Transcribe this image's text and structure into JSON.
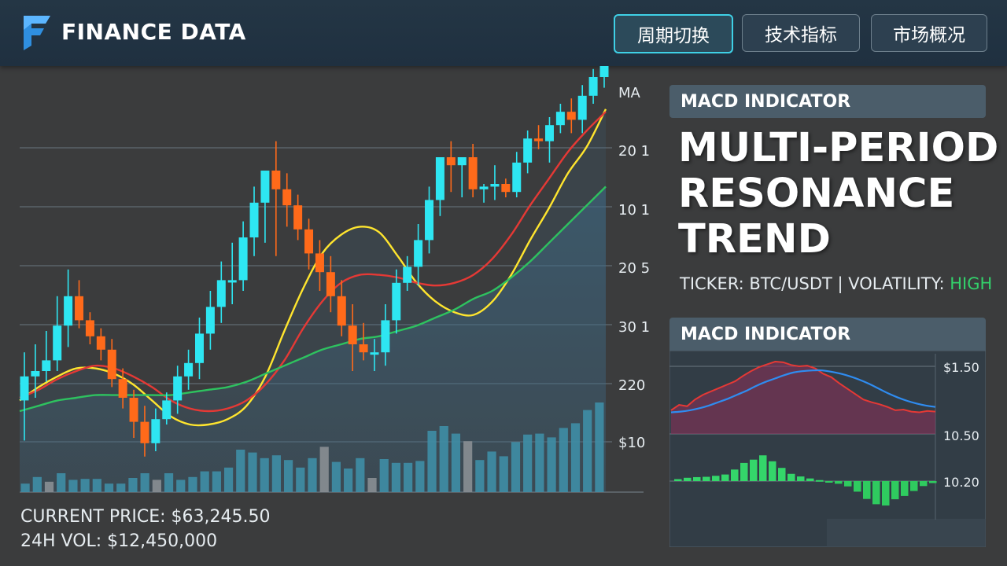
{
  "header": {
    "brand": "FINANCE DATA",
    "nav": [
      "周期切换",
      "技术指标",
      "市场概况"
    ],
    "active_nav": 0
  },
  "chart_data": [
    {
      "type": "candlestick",
      "y_tick_labels": [
        "MA",
        "20 1",
        "10 1",
        "20 5",
        "30 1",
        "220",
        "$10"
      ],
      "gridlines": true,
      "candles": [
        {
          "o": 0.19,
          "h": 0.37,
          "l": 0.04,
          "c": 0.28
        },
        {
          "o": 0.28,
          "h": 0.4,
          "l": 0.2,
          "c": 0.3
        },
        {
          "o": 0.3,
          "h": 0.45,
          "l": 0.26,
          "c": 0.34
        },
        {
          "o": 0.34,
          "h": 0.58,
          "l": 0.3,
          "c": 0.47
        },
        {
          "o": 0.47,
          "h": 0.68,
          "l": 0.39,
          "c": 0.58
        },
        {
          "o": 0.58,
          "h": 0.64,
          "l": 0.46,
          "c": 0.49
        },
        {
          "o": 0.49,
          "h": 0.52,
          "l": 0.4,
          "c": 0.43
        },
        {
          "o": 0.43,
          "h": 0.46,
          "l": 0.34,
          "c": 0.38
        },
        {
          "o": 0.38,
          "h": 0.42,
          "l": 0.24,
          "c": 0.27
        },
        {
          "o": 0.27,
          "h": 0.31,
          "l": 0.16,
          "c": 0.2
        },
        {
          "o": 0.2,
          "h": 0.23,
          "l": 0.05,
          "c": 0.11
        },
        {
          "o": 0.11,
          "h": 0.17,
          "l": -0.02,
          "c": 0.03
        },
        {
          "o": 0.03,
          "h": 0.16,
          "l": 0.0,
          "c": 0.12
        },
        {
          "o": 0.12,
          "h": 0.22,
          "l": 0.1,
          "c": 0.19
        },
        {
          "o": 0.19,
          "h": 0.32,
          "l": 0.14,
          "c": 0.28
        },
        {
          "o": 0.28,
          "h": 0.38,
          "l": 0.23,
          "c": 0.33
        },
        {
          "o": 0.33,
          "h": 0.5,
          "l": 0.27,
          "c": 0.44
        },
        {
          "o": 0.44,
          "h": 0.6,
          "l": 0.38,
          "c": 0.54
        },
        {
          "o": 0.54,
          "h": 0.71,
          "l": 0.48,
          "c": 0.64
        },
        {
          "o": 0.64,
          "h": 0.78,
          "l": 0.55,
          "c": 0.64
        },
        {
          "o": 0.64,
          "h": 0.86,
          "l": 0.6,
          "c": 0.8
        },
        {
          "o": 0.8,
          "h": 0.99,
          "l": 0.73,
          "c": 0.93
        },
        {
          "o": 0.93,
          "h": 1.01,
          "l": 0.78,
          "c": 1.05
        },
        {
          "o": 1.05,
          "h": 1.16,
          "l": 0.73,
          "c": 0.98
        },
        {
          "o": 0.98,
          "h": 1.04,
          "l": 0.84,
          "c": 0.92
        },
        {
          "o": 0.92,
          "h": 0.96,
          "l": 0.79,
          "c": 0.83
        },
        {
          "o": 0.83,
          "h": 0.87,
          "l": 0.68,
          "c": 0.74
        },
        {
          "o": 0.74,
          "h": 0.79,
          "l": 0.6,
          "c": 0.67
        },
        {
          "o": 0.67,
          "h": 0.73,
          "l": 0.52,
          "c": 0.58
        },
        {
          "o": 0.58,
          "h": 0.64,
          "l": 0.43,
          "c": 0.47
        },
        {
          "o": 0.47,
          "h": 0.55,
          "l": 0.3,
          "c": 0.4
        },
        {
          "o": 0.4,
          "h": 0.48,
          "l": 0.34,
          "c": 0.37
        },
        {
          "o": 0.37,
          "h": 0.42,
          "l": 0.3,
          "c": 0.37
        },
        {
          "o": 0.37,
          "h": 0.55,
          "l": 0.32,
          "c": 0.49
        },
        {
          "o": 0.49,
          "h": 0.68,
          "l": 0.44,
          "c": 0.63
        },
        {
          "o": 0.63,
          "h": 0.73,
          "l": 0.6,
          "c": 0.69
        },
        {
          "o": 0.69,
          "h": 0.85,
          "l": 0.62,
          "c": 0.79
        },
        {
          "o": 0.79,
          "h": 0.99,
          "l": 0.74,
          "c": 0.94
        },
        {
          "o": 0.94,
          "h": 1.1,
          "l": 0.88,
          "c": 1.1
        },
        {
          "o": 1.1,
          "h": 1.16,
          "l": 0.97,
          "c": 1.07
        },
        {
          "o": 1.07,
          "h": 1.1,
          "l": 0.95,
          "c": 1.1
        },
        {
          "o": 1.1,
          "h": 1.15,
          "l": 0.95,
          "c": 0.98
        },
        {
          "o": 0.98,
          "h": 1.0,
          "l": 0.93,
          "c": 0.99
        },
        {
          "o": 0.99,
          "h": 1.07,
          "l": 0.94,
          "c": 1.0
        },
        {
          "o": 1.0,
          "h": 1.02,
          "l": 0.95,
          "c": 0.97
        },
        {
          "o": 0.97,
          "h": 1.12,
          "l": 0.95,
          "c": 1.08
        },
        {
          "o": 1.08,
          "h": 1.2,
          "l": 1.04,
          "c": 1.17
        },
        {
          "o": 1.17,
          "h": 1.22,
          "l": 1.13,
          "c": 1.16
        },
        {
          "o": 1.16,
          "h": 1.25,
          "l": 1.08,
          "c": 1.22
        },
        {
          "o": 1.22,
          "h": 1.3,
          "l": 1.19,
          "c": 1.27
        },
        {
          "o": 1.27,
          "h": 1.32,
          "l": 1.19,
          "c": 1.24
        },
        {
          "o": 1.24,
          "h": 1.37,
          "l": 1.19,
          "c": 1.33
        },
        {
          "o": 1.33,
          "h": 1.43,
          "l": 1.3,
          "c": 1.4
        },
        {
          "o": 1.4,
          "h": 1.49,
          "l": 1.36,
          "c": 1.47
        }
      ],
      "volume": [
        0.09,
        0.16,
        0.11,
        0.2,
        0.13,
        0.14,
        0.14,
        0.09,
        0.09,
        0.15,
        0.2,
        0.13,
        0.2,
        0.13,
        0.16,
        0.22,
        0.22,
        0.26,
        0.45,
        0.42,
        0.36,
        0.39,
        0.34,
        0.26,
        0.36,
        0.48,
        0.32,
        0.25,
        0.36,
        0.15,
        0.35,
        0.31,
        0.31,
        0.33,
        0.65,
        0.7,
        0.62,
        0.54,
        0.34,
        0.43,
        0.38,
        0.53,
        0.61,
        0.62,
        0.58,
        0.68,
        0.73,
        0.87,
        0.95
      ],
      "ma_lines": [
        {
          "color": "#ffe52e",
          "values": [
            0.19,
            0.24,
            0.28,
            0.31,
            0.31,
            0.29,
            0.25,
            0.19,
            0.13,
            0.1,
            0.1,
            0.12,
            0.17,
            0.28,
            0.45,
            0.61,
            0.74,
            0.81,
            0.84,
            0.82,
            0.73,
            0.63,
            0.56,
            0.52,
            0.51,
            0.56,
            0.66,
            0.79,
            0.91,
            1.04,
            1.14,
            1.28
          ]
        },
        {
          "color": "#e53935",
          "values": [
            0.2,
            0.23,
            0.27,
            0.3,
            0.32,
            0.31,
            0.28,
            0.24,
            0.19,
            0.16,
            0.15,
            0.16,
            0.19,
            0.25,
            0.34,
            0.46,
            0.56,
            0.63,
            0.66,
            0.66,
            0.65,
            0.63,
            0.62,
            0.63,
            0.66,
            0.72,
            0.81,
            0.92,
            1.02,
            1.12,
            1.2,
            1.27
          ]
        },
        {
          "color": "#2ec25f",
          "values": [
            0.15,
            0.17,
            0.19,
            0.2,
            0.21,
            0.21,
            0.21,
            0.21,
            0.21,
            0.22,
            0.23,
            0.24,
            0.26,
            0.29,
            0.32,
            0.35,
            0.38,
            0.4,
            0.42,
            0.43,
            0.45,
            0.47,
            0.5,
            0.53,
            0.57,
            0.6,
            0.65,
            0.71,
            0.78,
            0.85,
            0.92,
            0.99
          ]
        }
      ]
    },
    {
      "type": "line",
      "y_tick_labels": [
        "$1.50",
        "10.50",
        "10.20"
      ],
      "series": [
        {
          "color": "#e53935",
          "values": [
            0.28,
            0.36,
            0.34,
            0.44,
            0.51,
            0.56,
            0.61,
            0.66,
            0.71,
            0.79,
            0.86,
            0.92,
            0.96,
            1.0,
            0.99,
            0.95,
            0.93,
            0.94,
            0.9,
            0.82,
            0.77,
            0.68,
            0.6,
            0.52,
            0.44,
            0.4,
            0.37,
            0.33,
            0.28,
            0.29,
            0.26,
            0.25,
            0.27,
            0.26
          ]
        },
        {
          "color": "#2f8cf0",
          "values": [
            0.25,
            0.26,
            0.28,
            0.31,
            0.35,
            0.4,
            0.45,
            0.51,
            0.57,
            0.64,
            0.7,
            0.75,
            0.8,
            0.84,
            0.86,
            0.87,
            0.87,
            0.85,
            0.82,
            0.78,
            0.73,
            0.67,
            0.6,
            0.53,
            0.47,
            0.42,
            0.38,
            0.35,
            0.33
          ]
        }
      ],
      "histogram": [
        0.06,
        0.1,
        0.12,
        0.13,
        0.16,
        0.2,
        0.35,
        0.55,
        0.65,
        0.78,
        0.6,
        0.4,
        0.22,
        0.14,
        0.08,
        0.03,
        -0.04,
        -0.08,
        -0.16,
        -0.32,
        -0.54,
        -0.7,
        -0.74,
        -0.55,
        -0.45,
        -0.3,
        -0.15,
        -0.06
      ]
    }
  ],
  "stats": {
    "price": "CURRENT PRICE: $63,245.50",
    "volume": "24H VOL: $12,450,000"
  },
  "panel": {
    "header": "MACD INDICATOR",
    "title_lines": [
      "MULTI-PERIOD",
      "RESONANCE",
      "TREND"
    ],
    "ticker_prefix": "TICKER: BTC/USDT | VOLATILITY: ",
    "ticker_level": "HIGH",
    "macd_header": "MACD INDICATOR"
  }
}
